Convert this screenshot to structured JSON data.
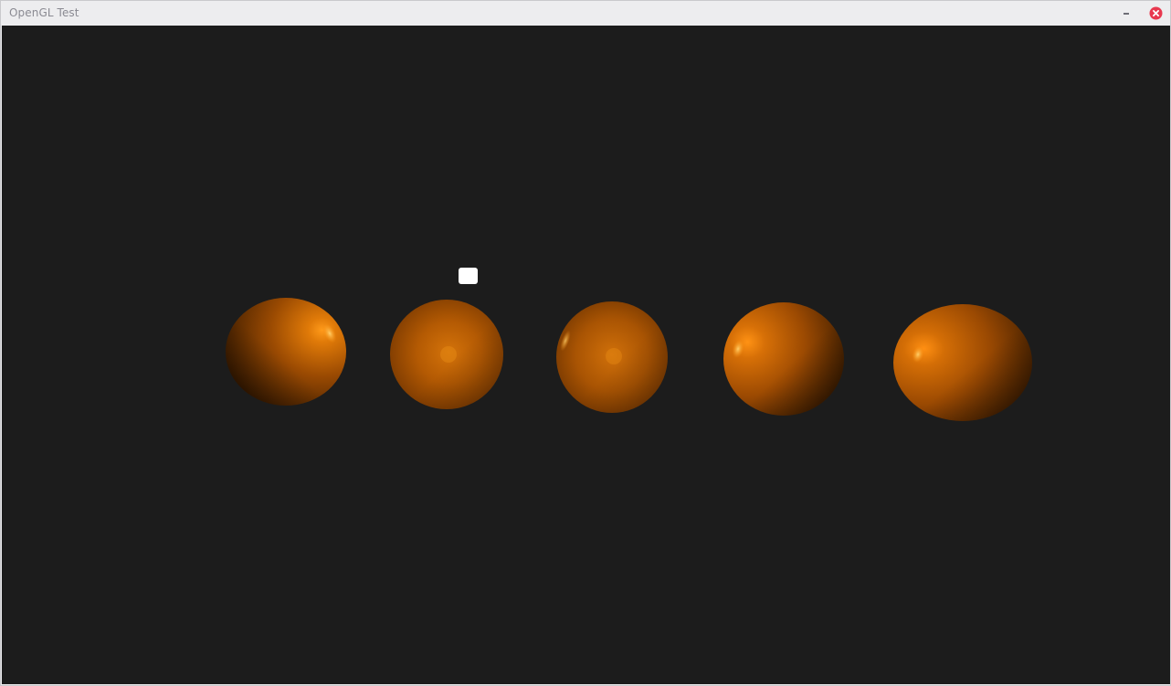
{
  "window": {
    "title": "OpenGL Test"
  },
  "colors": {
    "background": "#1c1c1c",
    "sphere_base": "#d26a00",
    "sphere_shadow": "#2b1400",
    "light_source": "#ffffff",
    "close_button": "#e8384f"
  },
  "icons": {
    "minimize": "minimize-icon",
    "close": "close-icon"
  },
  "scene": {
    "sphere_count": 5,
    "light_source_visible": true
  }
}
